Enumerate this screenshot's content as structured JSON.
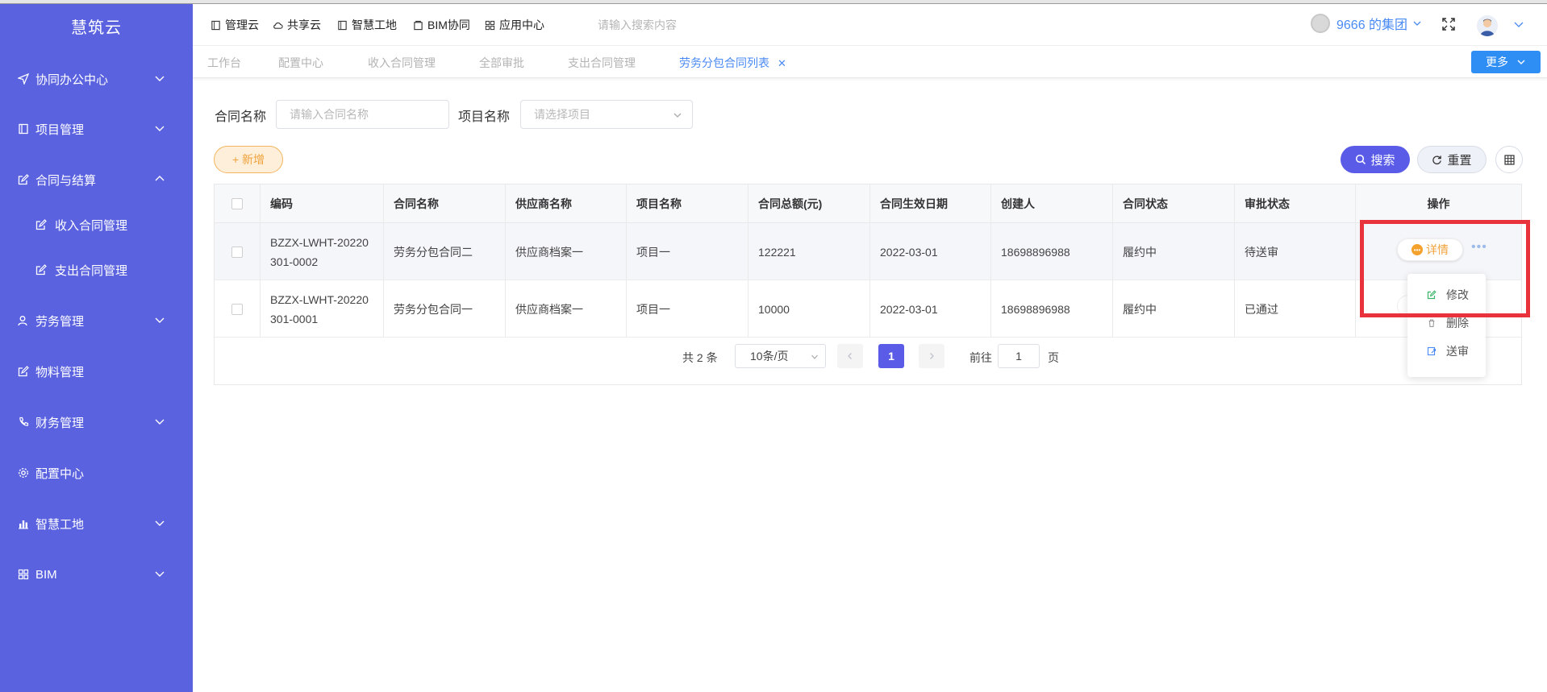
{
  "sidebar": {
    "brand": "慧筑云",
    "items": [
      {
        "label": "协同办公中心",
        "icon": "send-icon",
        "expandable": true
      },
      {
        "label": "项目管理",
        "icon": "book-icon",
        "expandable": true
      },
      {
        "label": "合同与结算",
        "icon": "edit-icon",
        "expandable": true,
        "expanded": true,
        "children": [
          {
            "label": "收入合同管理",
            "icon": "edit-icon"
          },
          {
            "label": "支出合同管理",
            "icon": "edit-icon"
          }
        ]
      },
      {
        "label": "劳务管理",
        "icon": "users-icon",
        "expandable": true
      },
      {
        "label": "物料管理",
        "icon": "edit-icon",
        "expandable": false
      },
      {
        "label": "财务管理",
        "icon": "phone-icon",
        "expandable": true
      },
      {
        "label": "配置中心",
        "icon": "gear-icon",
        "expandable": false
      },
      {
        "label": "智慧工地",
        "icon": "bar-chart-icon",
        "expandable": true
      },
      {
        "label": "BIM",
        "icon": "grid-icon",
        "expandable": true
      }
    ]
  },
  "header": {
    "nav": [
      {
        "label": "管理云",
        "icon": "book-icon"
      },
      {
        "label": "共享云",
        "icon": "cloud-icon"
      },
      {
        "label": "智慧工地",
        "icon": "book-icon"
      },
      {
        "label": "BIM协同",
        "icon": "box-icon"
      },
      {
        "label": "应用中心",
        "icon": "grid-icon"
      }
    ],
    "search_placeholder": "请输入搜索内容",
    "org_name": "9666 的集团"
  },
  "tabs": {
    "items": [
      "工作台",
      "配置中心",
      "收入合同管理",
      "全部审批",
      "支出合同管理",
      "劳务分包合同列表"
    ],
    "active_index": 5,
    "more_label": "更多"
  },
  "filters": {
    "contract_name_label": "合同名称",
    "contract_name_placeholder": "请输入合同名称",
    "project_name_label": "项目名称",
    "project_name_placeholder": "请选择项目"
  },
  "toolbar": {
    "add_label": "+ 新增",
    "search_label": "搜索",
    "reset_label": "重置"
  },
  "table": {
    "columns": [
      "编码",
      "合同名称",
      "供应商名称",
      "项目名称",
      "合同总额(元)",
      "合同生效日期",
      "创建人",
      "合同状态",
      "审批状态",
      "操作"
    ],
    "rows": [
      {
        "code_line1": "BZZX-LWHT-20220",
        "code_line2": "301-0002",
        "name": "劳务分包合同二",
        "supplier": "供应商档案一",
        "project": "项目一",
        "amount": "122221",
        "date": "2022-03-01",
        "creator": "18698896988",
        "status": "履约中",
        "approval": "待送审"
      },
      {
        "code_line1": "BZZX-LWHT-20220",
        "code_line2": "301-0001",
        "name": "劳务分包合同一",
        "supplier": "供应商档案一",
        "project": "项目一",
        "amount": "10000",
        "date": "2022-03-01",
        "creator": "18698896988",
        "status": "履约中",
        "approval": "已通过"
      }
    ],
    "detail_label": "详情"
  },
  "pagination": {
    "total_text": "共 2 条",
    "page_size": "10条/页",
    "current_page": "1",
    "goto_label": "前往",
    "goto_value": "1",
    "page_unit": "页"
  },
  "dropdown": {
    "items": [
      {
        "label": "修改",
        "icon": "edit-icon",
        "color": "#3bb36a"
      },
      {
        "label": "删除",
        "icon": "trash-icon",
        "color": "#999999"
      },
      {
        "label": "送审",
        "icon": "send-review-icon",
        "color": "#4a8af4"
      }
    ]
  },
  "colors": {
    "sidebar_bg": "#5a62df",
    "accent": "#4a8af4",
    "primary_button": "#5a5ce8",
    "add_button": "#f0a23a",
    "highlight": "#e8323c"
  }
}
